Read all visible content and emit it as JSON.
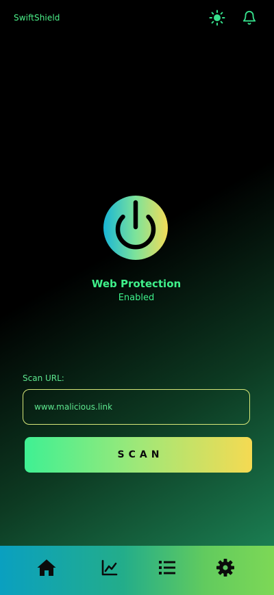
{
  "app": {
    "brand": "SwiftShield",
    "accent_color": "#3ff08a"
  },
  "header": {
    "icons": [
      "sun-icon",
      "bell-icon"
    ]
  },
  "protection": {
    "title": "Web Protection",
    "status": "Enabled",
    "icon": "power-icon"
  },
  "scan": {
    "label": "Scan URL:",
    "url_value": "www.malicious.link",
    "button_label": "SCAN"
  },
  "nav": {
    "items": [
      {
        "icon": "home-icon",
        "active": true
      },
      {
        "icon": "chart-icon",
        "active": false
      },
      {
        "icon": "list-icon",
        "active": false
      },
      {
        "icon": "gear-icon",
        "active": false
      }
    ]
  }
}
